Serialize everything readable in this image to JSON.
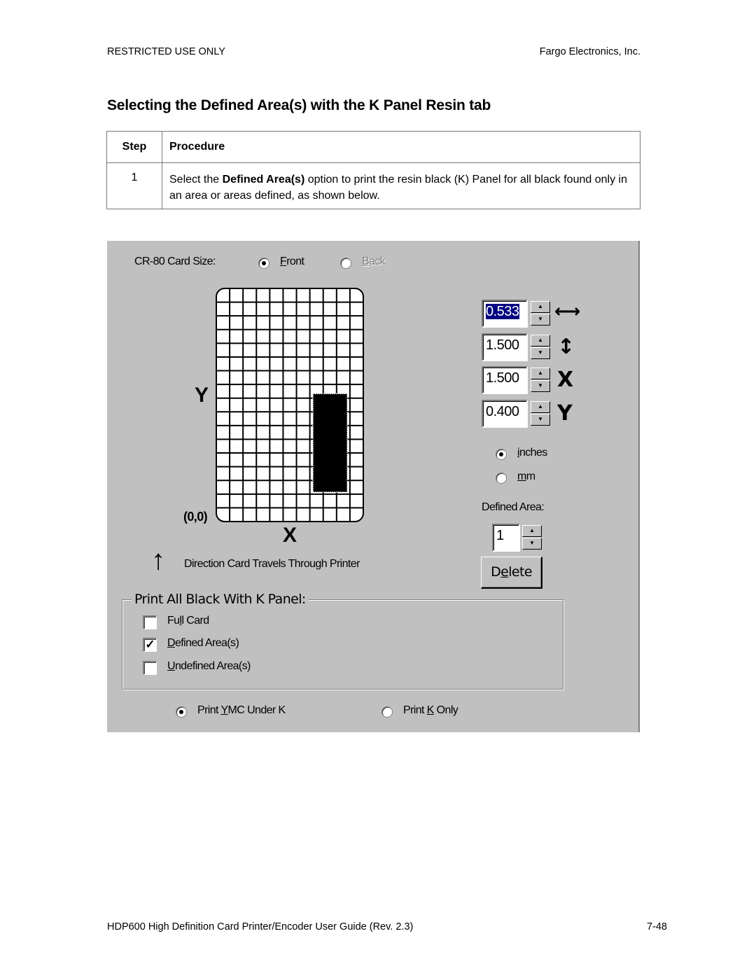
{
  "header": {
    "left": "RESTRICTED USE ONLY",
    "right": "Fargo Electronics, Inc."
  },
  "title": "Selecting the Defined Area(s) with the K Panel Resin tab",
  "procedure_table": {
    "columns": [
      "Step",
      "Procedure"
    ],
    "rows": [
      {
        "step": "1",
        "text_before": "Select the ",
        "text_bold": "Defined Area(s)",
        "text_after": " option to print the resin black (K) Panel for all black found only in an area or areas defined, as shown below."
      }
    ]
  },
  "dialog": {
    "card_size_label": "CR-80 Card Size:",
    "side_options": [
      {
        "label": "Front",
        "selected": true,
        "enabled": true
      },
      {
        "label": "Back",
        "selected": false,
        "enabled": false
      }
    ],
    "axis_y_label": "Y",
    "axis_x_label": "X",
    "origin_label": "(0,0)",
    "card_grid": {
      "columns": 11,
      "rows": 17,
      "defined_area": {
        "x_in": 1.5,
        "y_in": 0.4,
        "width_in": 0.533,
        "height_in": 1.5
      }
    },
    "direction_icon": "arrow-up-icon",
    "direction_label": "Direction Card Travels Through Printer",
    "spinners": [
      {
        "name": "width",
        "value": "0.533",
        "selected": true,
        "icon": "width-icon",
        "icon_glyph": "⟷"
      },
      {
        "name": "height",
        "value": "1.500",
        "selected": false,
        "icon": "height-icon",
        "icon_glyph": "↕"
      },
      {
        "name": "x",
        "value": "1.500",
        "selected": false,
        "icon": "x-icon",
        "icon_glyph": "X"
      },
      {
        "name": "y",
        "value": "0.400",
        "selected": false,
        "icon": "y-icon",
        "icon_glyph": "Y"
      }
    ],
    "units": [
      {
        "label": "inches",
        "selected": true
      },
      {
        "label": "mm",
        "selected": false
      }
    ],
    "defined_area_label": "Defined Area:",
    "defined_area_value": "1",
    "delete_button": "Delete",
    "group_title": "Print All Black With K Panel:",
    "checkboxes": [
      {
        "label": "Full Card",
        "checked": false
      },
      {
        "label": "Defined Area(s)",
        "checked": true
      },
      {
        "label": "Undefined Area(s)",
        "checked": false
      }
    ],
    "print_options": [
      {
        "label": "Print YMC Under K",
        "selected": true
      },
      {
        "label": "Print K Only",
        "selected": false
      }
    ]
  },
  "footer": {
    "left": "HDP600 High Definition Card Printer/Encoder User Guide (Rev. 2.3)",
    "right": "7-48"
  }
}
